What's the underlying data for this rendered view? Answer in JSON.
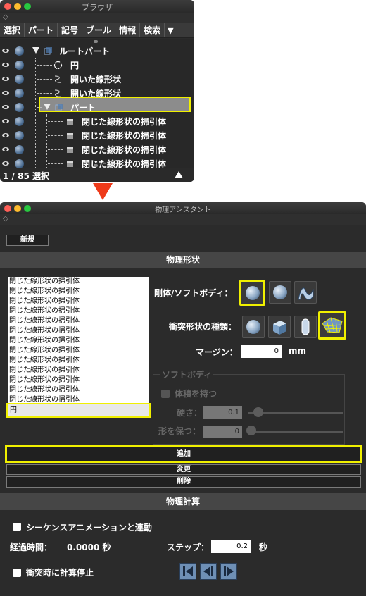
{
  "browser": {
    "title": "ブラウザ",
    "tabs": [
      "選択",
      "パート",
      "記号",
      "ブール",
      "情報",
      "検索"
    ],
    "tree_rows": [
      {
        "label": "ルートパート",
        "kind": "part"
      },
      {
        "label": "円",
        "kind": "circle",
        "selected": true
      },
      {
        "label": "開いた線形状",
        "kind": "curve"
      },
      {
        "label": "開いた線形状",
        "kind": "curve"
      },
      {
        "label": "パート",
        "kind": "part"
      },
      {
        "label": "閉じた線形状の掃引体",
        "kind": "sweep"
      },
      {
        "label": "閉じた線形状の掃引体",
        "kind": "sweep"
      },
      {
        "label": "閉じた線形状の掃引体",
        "kind": "sweep"
      },
      {
        "label": "閉じた線形状の掃引体",
        "kind": "sweep"
      }
    ],
    "status": "1 / 85 選択"
  },
  "assistant": {
    "title": "物理アシスタント",
    "new_button": "新規",
    "section_shape": "物理形状",
    "list_items": [
      "閉じた線形状の掃引体",
      "閉じた線形状の掃引体",
      "閉じた線形状の掃引体",
      "閉じた線形状の掃引体",
      "閉じた線形状の掃引体",
      "閉じた線形状の掃引体",
      "閉じた線形状の掃引体",
      "閉じた線形状の掃引体",
      "閉じた線形状の掃引体",
      "閉じた線形状の掃引体",
      "閉じた線形状の掃引体",
      "閉じた線形状の掃引体",
      "閉じた線形状の掃引体"
    ],
    "selected_item": "円",
    "rigid_soft_label": "剛体/ソフトボディ：",
    "collision_label": "衝突形状の種類：",
    "margin_label": "マージン：",
    "margin_value": "0",
    "margin_unit": "mm",
    "softbody_group": "ソフトボディ",
    "keep_volume": "体積を持つ",
    "hardness_label": "硬さ：",
    "hardness_value": "0.1",
    "shape_keep_label": "形を保つ：",
    "shape_keep_value": "0",
    "add_button": "追加",
    "change_button": "変更",
    "delete_button": "削除",
    "section_calc": "物理計算",
    "sequence_link": "シーケンスアニメーションと連動",
    "elapsed_label": "経過時間：",
    "elapsed_value": "0.0000 秒",
    "step_label": "ステップ：",
    "step_value": "0.2",
    "step_unit": "秒",
    "stop_on_collision": "衝突時に計算停止"
  }
}
